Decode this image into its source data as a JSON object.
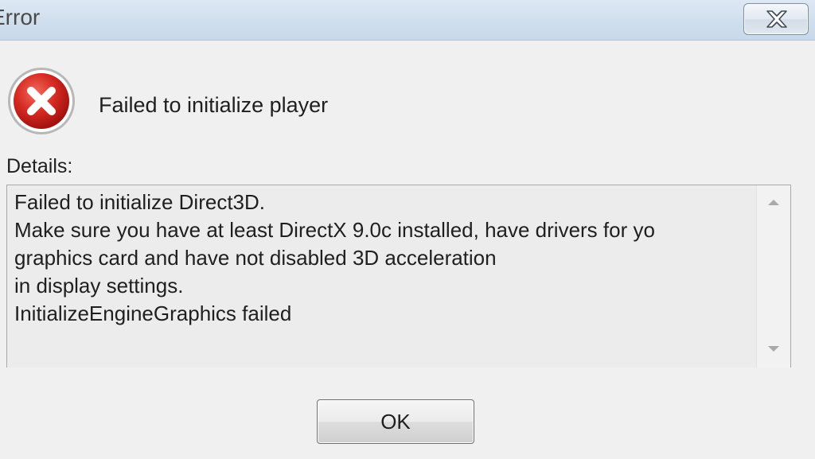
{
  "window": {
    "title": "Error",
    "close_icon": "close-icon"
  },
  "message": {
    "icon": "error-icon",
    "text": "Failed to initialize player"
  },
  "details": {
    "label": "Details:",
    "lines": [
      "Failed to initialize Direct3D.",
      "Make sure you have at least DirectX 9.0c installed, have drivers for yo",
      "graphics card and have not disabled 3D acceleration",
      "in display settings.",
      "InitializeEngineGraphics failed"
    ],
    "scroll_up_icon": "scroll-up-arrow-icon",
    "scroll_down_icon": "scroll-down-arrow-icon"
  },
  "buttons": {
    "ok_label": "OK"
  },
  "colors": {
    "error_red": "#c8201f",
    "titlebar": "#d6e3f0",
    "dialog_bg": "#f0f0f0"
  }
}
